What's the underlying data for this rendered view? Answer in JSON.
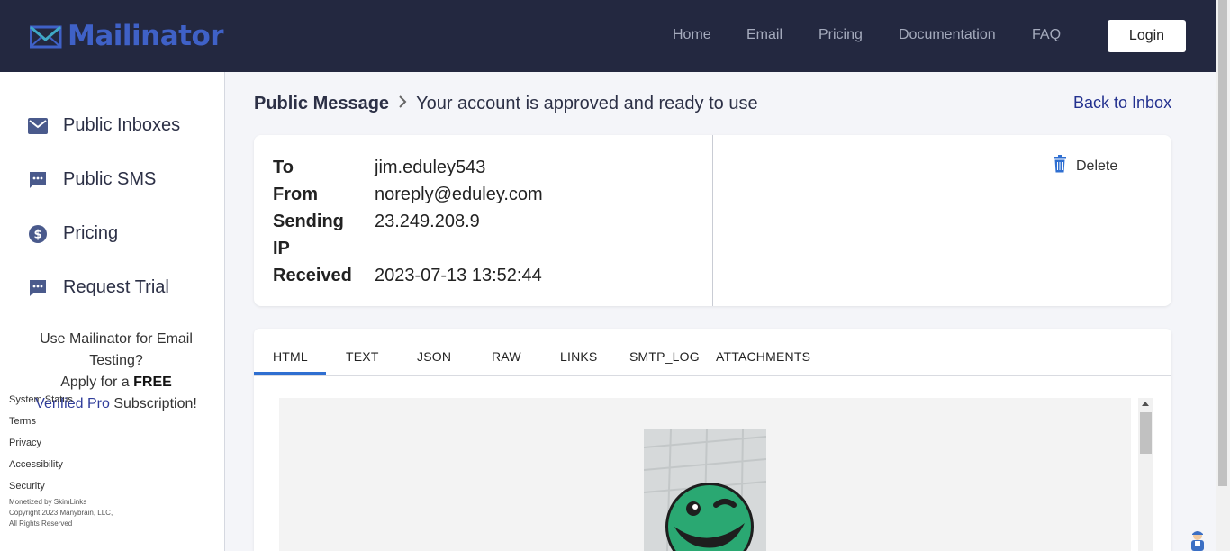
{
  "brand": {
    "name": "Mailinator",
    "color": "#3f61c7"
  },
  "nav": {
    "items": [
      "Home",
      "Email",
      "Pricing",
      "Documentation",
      "FAQ"
    ],
    "login_label": "Login"
  },
  "sidebar": {
    "items": [
      {
        "label": "Public Inboxes",
        "icon": "mail-icon"
      },
      {
        "label": "Public SMS",
        "icon": "chat-icon"
      },
      {
        "label": "Pricing",
        "icon": "dollar-icon"
      },
      {
        "label": "Request Trial",
        "icon": "chat-icon"
      }
    ],
    "promo": {
      "line1": "Use Mailinator for Email Testing?",
      "apply": "Apply for a",
      "free": "FREE",
      "link": "Verified Pro",
      "tail": "Subscription!"
    },
    "footer_links": [
      "System Status",
      "Terms",
      "Privacy",
      "Accessibility",
      "Security"
    ],
    "fine_print": [
      "Monetized by SkimLinks",
      "Copyright 2023 Manybrain, LLC,",
      "All Rights Reserved"
    ]
  },
  "breadcrumb": {
    "root": "Public Message",
    "subject": "Your account is approved and ready to use"
  },
  "back_link": "Back to Inbox",
  "message": {
    "labels": [
      "To",
      "From",
      "Sending",
      "IP",
      "Received"
    ],
    "to": "jim.eduley543",
    "from": "noreply@eduley.com",
    "sending_ip": "23.249.208.9",
    "received": "2023-07-13 13:52:44"
  },
  "delete_label": "Delete",
  "tabs": [
    "HTML",
    "TEXT",
    "JSON",
    "RAW",
    "LINKS",
    "SMTP_LOG",
    "ATTACHMENTS"
  ],
  "active_tab": "HTML",
  "colors": {
    "topbar": "#232840",
    "accent": "#2f6fd1",
    "link": "#23318f",
    "smiley": "#2aa872"
  }
}
